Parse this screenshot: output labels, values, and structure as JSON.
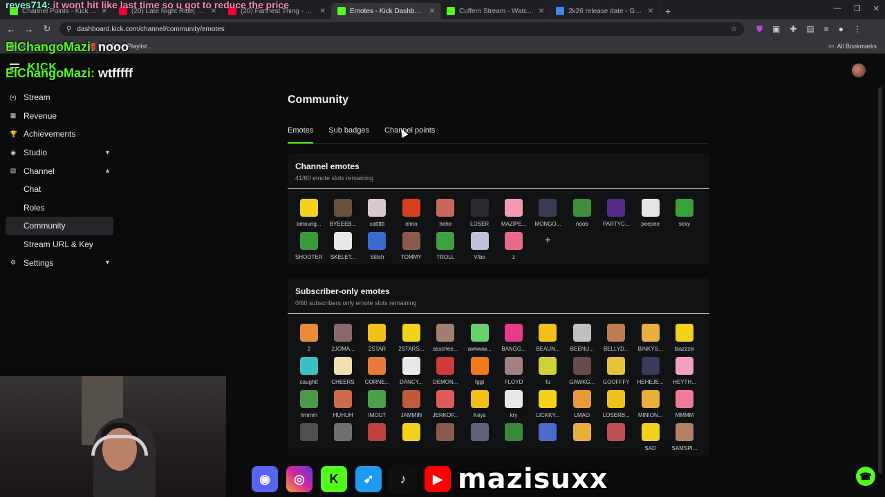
{
  "browser": {
    "tabs": [
      {
        "title": "Channel Points - Kick Dashboard",
        "color": "#53fc18",
        "active": false
      },
      {
        "title": "(20) Late Night Ride| Starboy |",
        "color": "#ff0033",
        "active": false
      },
      {
        "title": "(20) Farthest Thing - YouTube",
        "color": "#ff0033",
        "active": false
      },
      {
        "title": "Emotes - Kick Dashboard",
        "color": "#53fc18",
        "active": true
      },
      {
        "title": "Cuffem Stream - Watch Live on",
        "color": "#53fc18",
        "active": false
      },
      {
        "title": "2k26 release date - Google Sea",
        "color": "#4285f4",
        "active": false
      }
    ],
    "url": "dashboard.kick.com/channel/community/emotes",
    "bookmarks": [
      {
        "label": "Purchases · Stake.us",
        "color": "#dcdcdc"
      },
      {
        "label": "MaziSux · Playlist ...",
        "color": "#ff3b5c"
      }
    ],
    "all_bookmarks": "All Bookmarks"
  },
  "overlay": {
    "chat1_user": "reyes714:",
    "chat1_text": "it wont hit like last time so u got to reduce the price",
    "chat2_user": "ElChangoMazi:",
    "chat2_text": "nooo",
    "chat3_user": "ElChangoMazi:",
    "chat3_text": "wtfffff"
  },
  "sidebar": {
    "items": [
      {
        "label": "Stream",
        "icon": "(•)"
      },
      {
        "label": "Revenue",
        "icon": "▦"
      },
      {
        "label": "Achievements",
        "icon": "🏆"
      },
      {
        "label": "Studio",
        "icon": "◉",
        "chevron": "▾"
      },
      {
        "label": "Channel",
        "icon": "▤",
        "chevron": "▴"
      },
      {
        "label": "Chat",
        "sub": true
      },
      {
        "label": "Roles",
        "sub": true
      },
      {
        "label": "Community",
        "sub": true,
        "selected": true
      },
      {
        "label": "Stream URL & Key",
        "sub": true
      },
      {
        "label": "Settings",
        "icon": "⚙",
        "chevron": "▾"
      }
    ]
  },
  "main": {
    "title": "Community",
    "tabs": [
      "Emotes",
      "Sub badges",
      "Channel points"
    ],
    "channel_emotes": {
      "title": "Channel emotes",
      "subtitle": "41/60 emote slots remaining",
      "emotes": [
        {
          "label": "amoung...",
          "color": "#f2d21b"
        },
        {
          "label": "BYEEEB...",
          "color": "#6b4f3a"
        },
        {
          "label": "catttttt",
          "color": "#d9c7cf"
        },
        {
          "label": "elmo",
          "color": "#d6401f"
        },
        {
          "label": "hehe",
          "color": "#c9665a"
        },
        {
          "label": "LOSER",
          "color": "#2a2a30"
        },
        {
          "label": "MAZIPE...",
          "color": "#f29ab0"
        },
        {
          "label": "MONGO...",
          "color": "#3a3a55"
        },
        {
          "label": "noob",
          "color": "#3f8f3a"
        },
        {
          "label": "PARTYC...",
          "color": "#5a2a8a"
        },
        {
          "label": "peepee",
          "color": "#e5e5e5"
        },
        {
          "label": "sexy",
          "color": "#3aa03a"
        },
        {
          "label": "SHOOTER",
          "color": "#3b9a3b"
        },
        {
          "label": "SKELET...",
          "color": "#e8e8e8"
        },
        {
          "label": "Stitch",
          "color": "#3a6ad0"
        },
        {
          "label": "TOMMY",
          "color": "#8a5a4a"
        },
        {
          "label": "TROLL",
          "color": "#3fa03f"
        },
        {
          "label": "VIbe",
          "color": "#c0c0e0"
        },
        {
          "label": "z",
          "color": "#e86a8a"
        }
      ],
      "add_label": "+"
    },
    "subscriber_emotes": {
      "title": "Subscriber-only emotes",
      "subtitle": "0/60 subscribers only emote slots remaining",
      "emotes": [
        {
          "label": "2",
          "color": "#e88a3a"
        },
        {
          "label": "2JOMA...",
          "color": "#8a6a6a"
        },
        {
          "label": "2STAR",
          "color": "#f2c01b"
        },
        {
          "label": "2STARS...",
          "color": "#f2d21b"
        },
        {
          "label": "asschee...",
          "color": "#a08070"
        },
        {
          "label": "awwww...",
          "color": "#6ad06a"
        },
        {
          "label": "BANGG...",
          "color": "#e83a8a"
        },
        {
          "label": "BEAUN...",
          "color": "#f2c01b"
        },
        {
          "label": "BEENU...",
          "color": "#c0c0c0"
        },
        {
          "label": "BELLYD...",
          "color": "#c07a50"
        },
        {
          "label": "BINKYS...",
          "color": "#e8b03a"
        },
        {
          "label": "blazzzin",
          "color": "#f2d21b"
        },
        {
          "label": "caughtt",
          "color": "#3ac0c0"
        },
        {
          "label": "CHEERS",
          "color": "#f0e0b0"
        },
        {
          "label": "CORNE...",
          "color": "#e87a3a"
        },
        {
          "label": "DANCY...",
          "color": "#e8e8e8"
        },
        {
          "label": "DEMON...",
          "color": "#d03a3a"
        },
        {
          "label": "fggt",
          "color": "#f27a1b"
        },
        {
          "label": "FLOYD",
          "color": "#a08080"
        },
        {
          "label": "fu",
          "color": "#d0d03a"
        },
        {
          "label": "GAWKG...",
          "color": "#6a4a4a"
        },
        {
          "label": "GOOFFFY",
          "color": "#e8c03a"
        },
        {
          "label": "HEHEJE...",
          "color": "#3a3a5a"
        },
        {
          "label": "HEYTH...",
          "color": "#f0a0c0"
        },
        {
          "label": "hmmm",
          "color": "#4a9a4a"
        },
        {
          "label": "HUHUH",
          "color": "#d06a4a"
        },
        {
          "label": "IMOUT",
          "color": "#4aa04a"
        },
        {
          "label": "JAMMIN",
          "color": "#c05a3a"
        },
        {
          "label": "JERKOF...",
          "color": "#e05a5a"
        },
        {
          "label": "Keys",
          "color": "#f2c01b"
        },
        {
          "label": "kry",
          "color": "#e8e8e8"
        },
        {
          "label": "LICKKY...",
          "color": "#f2d21b"
        },
        {
          "label": "LMAO",
          "color": "#e89a3a"
        },
        {
          "label": "LOSERB...",
          "color": "#f2c01b"
        },
        {
          "label": "MINION...",
          "color": "#e8b03a"
        },
        {
          "label": "MMMM",
          "color": "#f07a9a"
        },
        {
          "label": "",
          "color": "#505050"
        },
        {
          "label": "",
          "color": "#707070"
        },
        {
          "label": "",
          "color": "#c04040"
        },
        {
          "label": "",
          "color": "#f2d21b"
        },
        {
          "label": "",
          "color": "#8a5a4a"
        },
        {
          "label": "",
          "color": "#606080"
        },
        {
          "label": "",
          "color": "#3a8a3a"
        },
        {
          "label": "",
          "color": "#4a6ad0"
        },
        {
          "label": "",
          "color": "#e8b03a"
        },
        {
          "label": "",
          "color": "#c05050"
        },
        {
          "label": "SAD",
          "color": "#f2d21b"
        },
        {
          "label": "SAMSPI...",
          "color": "#b08060"
        }
      ]
    }
  },
  "banner": {
    "name": "mazisuxx"
  },
  "colors": {
    "accent": "#53fc18",
    "background": "#0b0b0c"
  }
}
